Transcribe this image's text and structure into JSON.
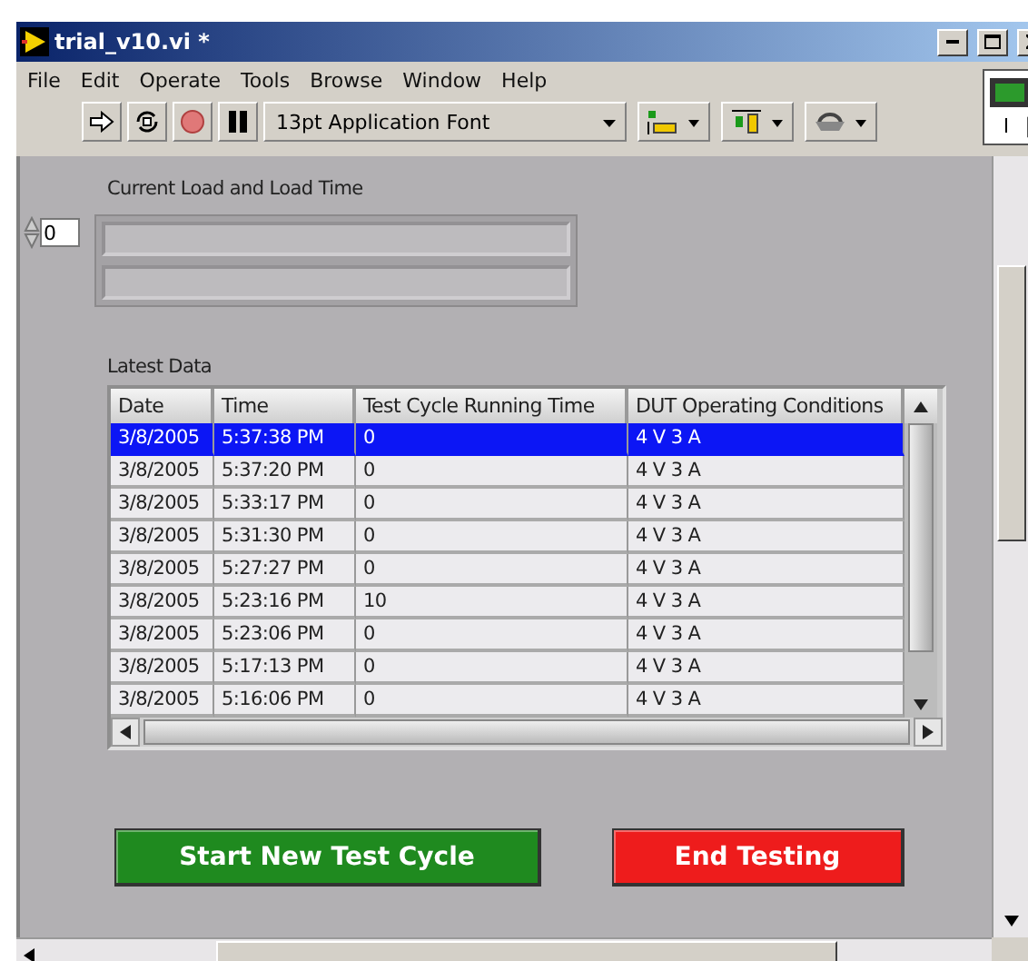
{
  "window": {
    "title": "trial_v10.vi *"
  },
  "menu": [
    "File",
    "Edit",
    "Operate",
    "Tools",
    "Browse",
    "Window",
    "Help"
  ],
  "toolbar": {
    "font": "13pt Application Font"
  },
  "load_array": {
    "label": "Current Load and Load Time",
    "index": "0"
  },
  "table": {
    "label": "Latest Data",
    "columns": [
      "Date",
      "Time",
      "Test Cycle Running Time",
      "DUT Operating Conditions"
    ],
    "rows": [
      {
        "cells": [
          "3/8/2005",
          "5:37:38 PM",
          "0",
          "4 V 3 A"
        ],
        "selected": true
      },
      {
        "cells": [
          "3/8/2005",
          "5:37:20 PM",
          "0",
          "4 V 3 A"
        ],
        "selected": false
      },
      {
        "cells": [
          "3/8/2005",
          "5:33:17 PM",
          "0",
          "4 V 3 A"
        ],
        "selected": false
      },
      {
        "cells": [
          "3/8/2005",
          "5:31:30 PM",
          "0",
          "4 V 3 A"
        ],
        "selected": false
      },
      {
        "cells": [
          "3/8/2005",
          "5:27:27 PM",
          "0",
          "4 V 3 A"
        ],
        "selected": false
      },
      {
        "cells": [
          "3/8/2005",
          "5:23:16 PM",
          "10",
          "4 V 3 A"
        ],
        "selected": false
      },
      {
        "cells": [
          "3/8/2005",
          "5:23:06 PM",
          "0",
          "4 V 3 A"
        ],
        "selected": false
      },
      {
        "cells": [
          "3/8/2005",
          "5:17:13 PM",
          "0",
          "4 V 3 A"
        ],
        "selected": false
      },
      {
        "cells": [
          "3/8/2005",
          "5:16:06 PM",
          "0",
          "4 V 3 A"
        ],
        "selected": false
      }
    ]
  },
  "buttons": [
    {
      "label": "Start New Test Cycle",
      "color": "#1f8a1f"
    },
    {
      "label": "End Testing",
      "color": "#ee1c1c"
    }
  ]
}
